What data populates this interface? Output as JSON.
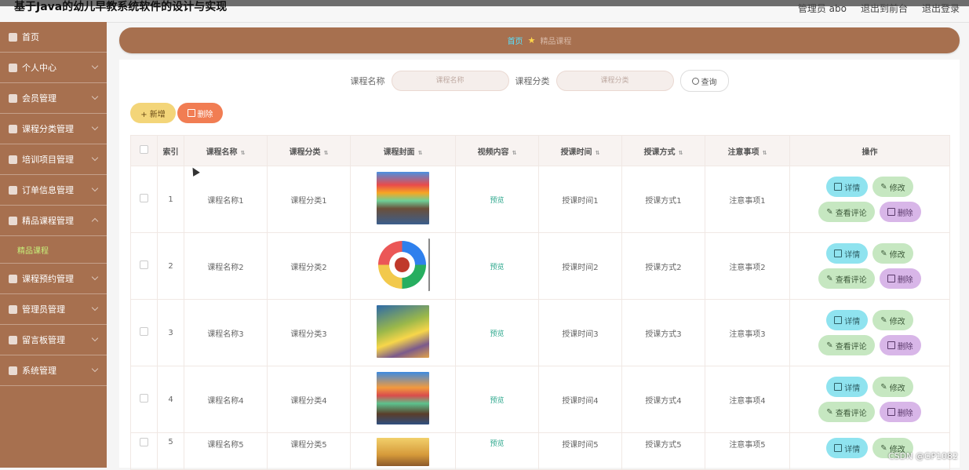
{
  "app": {
    "title": "基于Java的幼儿早教系统软件的设计与实现",
    "user_label": "管理员 abo",
    "to_front_label": "退出到前台",
    "logout_label": "退出登录"
  },
  "sidebar": {
    "items": [
      {
        "label": "首页",
        "icon": "home-icon"
      },
      {
        "label": "个人中心",
        "icon": "user-icon"
      },
      {
        "label": "会员管理",
        "icon": "list-icon"
      },
      {
        "label": "课程分类管理",
        "icon": "calendar-icon"
      },
      {
        "label": "培训项目管理",
        "icon": "location-icon"
      },
      {
        "label": "订单信息管理",
        "icon": "grid-icon"
      },
      {
        "label": "精品课程管理",
        "icon": "circle-icon"
      },
      {
        "label": "课程预约管理",
        "icon": "document-icon"
      },
      {
        "label": "管理员管理",
        "icon": "admin-icon"
      },
      {
        "label": "留言板管理",
        "icon": "chart-icon"
      },
      {
        "label": "系统管理",
        "icon": "settings-icon"
      }
    ],
    "active_sub_item": "精品课程"
  },
  "breadcrumb": {
    "home": "首页",
    "current": "精品课程",
    "icon": "star-icon"
  },
  "search": {
    "course_name_label": "课程名称",
    "course_name_placeholder": "课程名称",
    "course_category_label": "课程分类",
    "course_category_placeholder": "课程分类",
    "query_label": "查询"
  },
  "actions": {
    "add_label": "+ 新增",
    "delete_label": "删除"
  },
  "table": {
    "headers": [
      "",
      "索引",
      "课程名称",
      "课程分类",
      "课程封面",
      "视频内容",
      "授课时间",
      "授课方式",
      "注意事项",
      "操作"
    ],
    "rows": [
      {
        "index": "1",
        "name": "课程名称1",
        "category": "课程分类1",
        "video": "预览",
        "time": "授课时间1",
        "method": "授课方式1",
        "notes": "注意事项1"
      },
      {
        "index": "2",
        "name": "课程名称2",
        "category": "课程分类2",
        "video": "预览",
        "time": "授课时间2",
        "method": "授课方式2",
        "notes": "注意事项2"
      },
      {
        "index": "3",
        "name": "课程名称3",
        "category": "课程分类3",
        "video": "预览",
        "time": "授课时间3",
        "method": "授课方式3",
        "notes": "注意事项3"
      },
      {
        "index": "4",
        "name": "课程名称4",
        "category": "课程分类4",
        "video": "预览",
        "time": "授课时间4",
        "method": "授课方式4",
        "notes": "注意事项4"
      },
      {
        "index": "5",
        "name": "课程名称5",
        "category": "课程分类5",
        "video": "预览",
        "time": "授课时间5",
        "method": "授课方式5",
        "notes": "注意事项5"
      }
    ],
    "row_actions": {
      "detail": "详情",
      "edit": "修改",
      "comments": "查看评论",
      "delete": "删除"
    }
  },
  "watermark": "CSDN @GP1082"
}
